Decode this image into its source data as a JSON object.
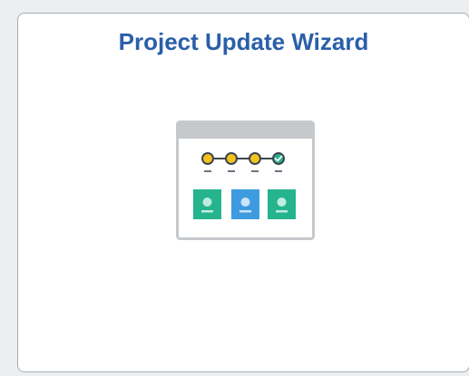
{
  "tile": {
    "title": "Project Update Wizard"
  },
  "illustration": {
    "icon": "wizard-steps-icon",
    "steps_total": 4,
    "steps_completed": 4,
    "colors": {
      "title": "#2a5fa8",
      "window_border": "#c5c9cc",
      "window_header": "#c5c9cc",
      "step_node": "#f2c31a",
      "step_node_done": "#25b48e",
      "card_green": "#25b48e",
      "card_blue": "#3e9be0"
    }
  }
}
